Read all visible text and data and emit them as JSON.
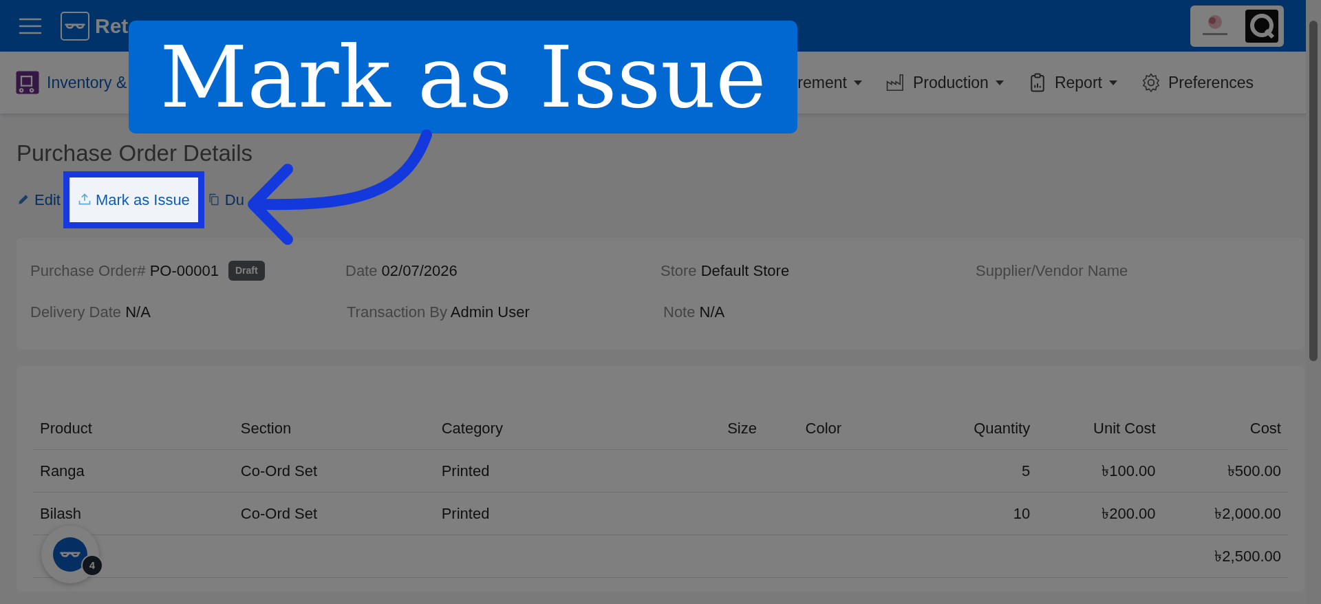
{
  "app": {
    "title": "Ret"
  },
  "nav": [
    {
      "label": "Inventory &",
      "kind": "inventory",
      "dropdown": false
    },
    {
      "label": "rement",
      "kind": "plain",
      "dropdown": true
    },
    {
      "label": "Production",
      "kind": "production",
      "dropdown": true
    },
    {
      "label": "Report",
      "kind": "report",
      "dropdown": true
    },
    {
      "label": "Preferences",
      "kind": "settings",
      "dropdown": false
    }
  ],
  "page": {
    "title": "Purchase Order Details"
  },
  "actions": [
    {
      "label": "Edit",
      "kind": "edit",
      "highlighted": false
    },
    {
      "label": "Mark as Issue",
      "kind": "issue",
      "highlighted": true
    },
    {
      "label": "Du",
      "kind": "duplicate",
      "highlighted": false
    }
  ],
  "detail_rows": [
    [
      {
        "label": "Purchase Order#",
        "value": "PO-00001",
        "badge": "Draft"
      },
      {
        "label": "Date",
        "value": "02/07/2026"
      },
      {
        "label": "Store",
        "value": "Default Store"
      },
      {
        "label": "Supplier/Vendor Name"
      }
    ],
    [
      {
        "label": "Delivery Date",
        "value": "N/A"
      },
      {
        "label": "Transaction By",
        "value": "Admin User"
      },
      {
        "label": "Note",
        "value": "N/A"
      }
    ]
  ],
  "table": {
    "columns": [
      "Product",
      "Section",
      "Category",
      "Size",
      "Color",
      "Quantity",
      "Unit Cost",
      "Cost"
    ],
    "rows": [
      [
        "Ranga",
        "Co-Ord Set",
        "Printed",
        "",
        "",
        "5",
        "৳100.00",
        "৳500.00"
      ],
      [
        "Bilash",
        "Co-Ord Set",
        "Printed",
        "",
        "",
        "10",
        "৳200.00",
        "৳2,000.00"
      ]
    ],
    "total": "৳2,500.00"
  },
  "callout": {
    "text": "Mark as Issue"
  },
  "help_widget": {
    "badge": "4"
  }
}
